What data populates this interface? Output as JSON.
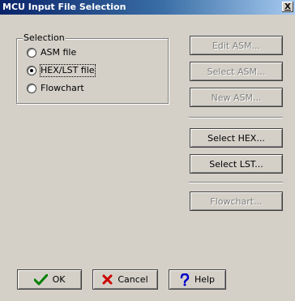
{
  "window": {
    "title": "MCU Input File Selection",
    "close_label": "X"
  },
  "selection": {
    "legend": "Selection",
    "options": [
      {
        "label": "ASM file",
        "checked": false
      },
      {
        "label": "HEX/LST file",
        "checked": true
      },
      {
        "label": "Flowchart",
        "checked": false
      }
    ]
  },
  "buttons": {
    "edit_asm": "Edit ASM...",
    "select_asm": "Select ASM...",
    "new_asm": "New ASM...",
    "select_hex": "Select HEX...",
    "select_lst": "Select LST...",
    "flowchart": "Flowchart...",
    "ok": "OK",
    "cancel": "Cancel",
    "help": "Help"
  },
  "icons": {
    "ok": "checkmark-icon",
    "cancel": "x-icon",
    "help": "question-mark-icon"
  },
  "colors": {
    "title_start": "#0a246a",
    "title_end": "#a6caf0",
    "ok_green": "#008000",
    "cancel_red": "#cc0000",
    "help_blue": "#0000cc"
  }
}
